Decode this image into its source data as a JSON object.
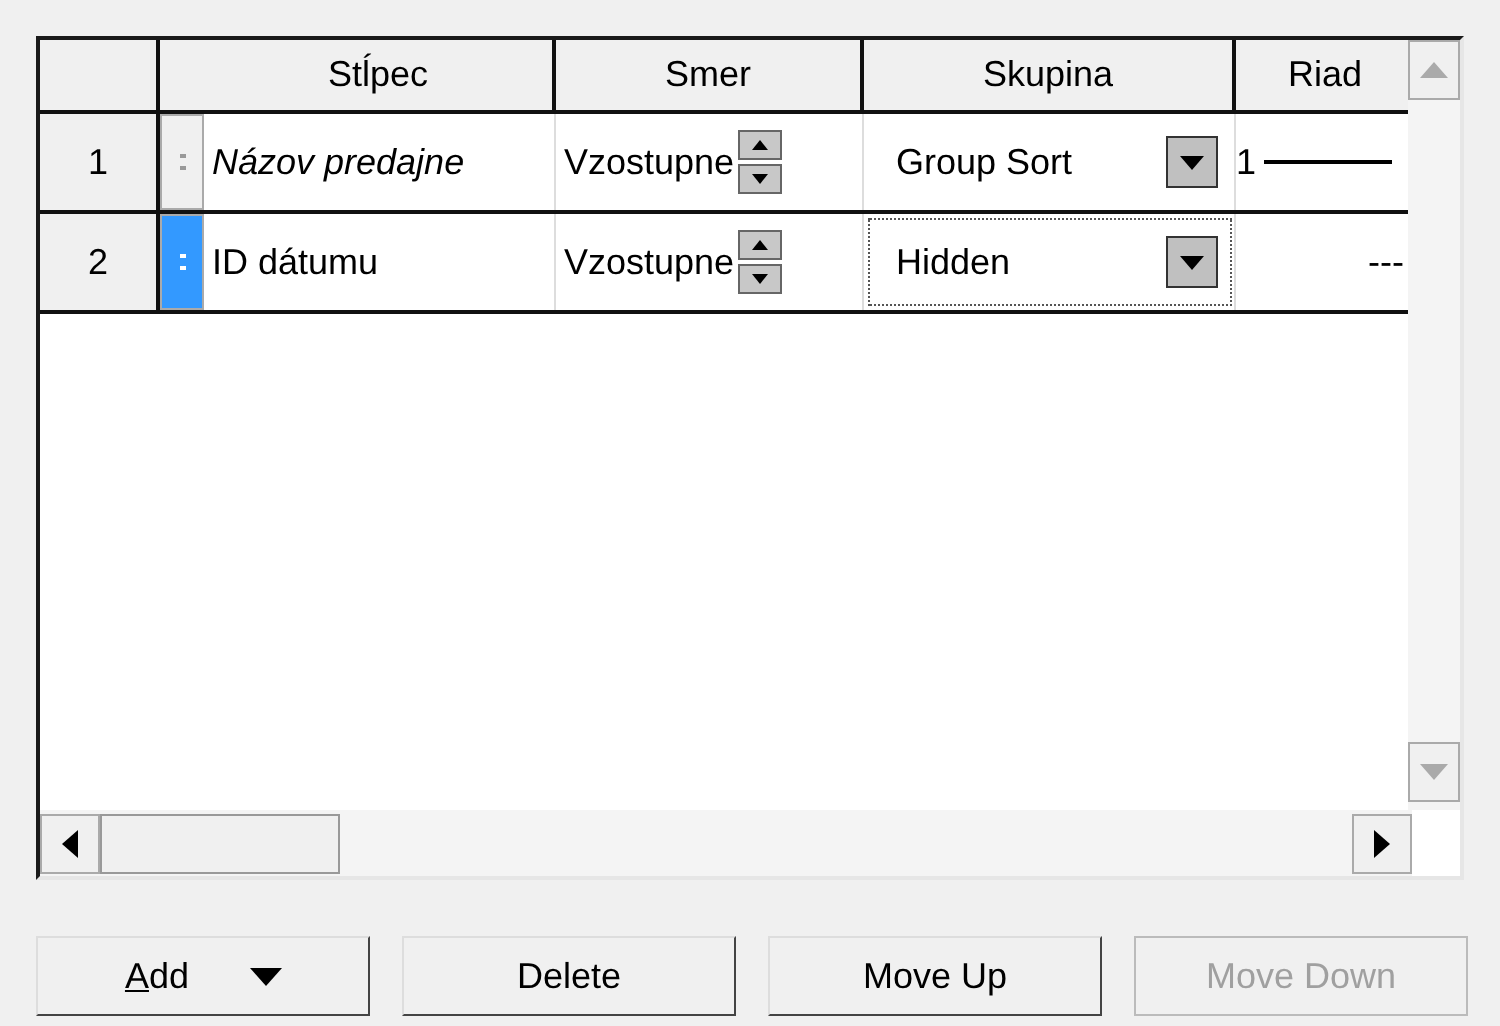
{
  "columns": [
    "Stĺpec",
    "Smer",
    "Skupina",
    "Riad"
  ],
  "rows": [
    {
      "number": "1",
      "selected": false,
      "column": "Názov predajne",
      "italic": true,
      "direction": "Vzostupne",
      "group": "Group Sort",
      "focused": false,
      "column_4": {
        "kind": "numbered-line",
        "text": "1"
      }
    },
    {
      "number": "2",
      "selected": true,
      "column": "ID dátumu",
      "italic": false,
      "direction": "Vzostupne",
      "group": "Hidden",
      "focused": true,
      "column_4": {
        "kind": "dashes",
        "text": "---"
      }
    }
  ],
  "buttons": [
    {
      "label": "Add",
      "dropdown": true,
      "mnemonic": true,
      "disabled": false
    },
    {
      "label": "Delete",
      "dropdown": false,
      "mnemonic": false,
      "disabled": false
    },
    {
      "label": "Move Up",
      "dropdown": false,
      "mnemonic": false,
      "disabled": false
    },
    {
      "label": "Move Down",
      "dropdown": false,
      "mnemonic": false,
      "disabled": true
    }
  ]
}
